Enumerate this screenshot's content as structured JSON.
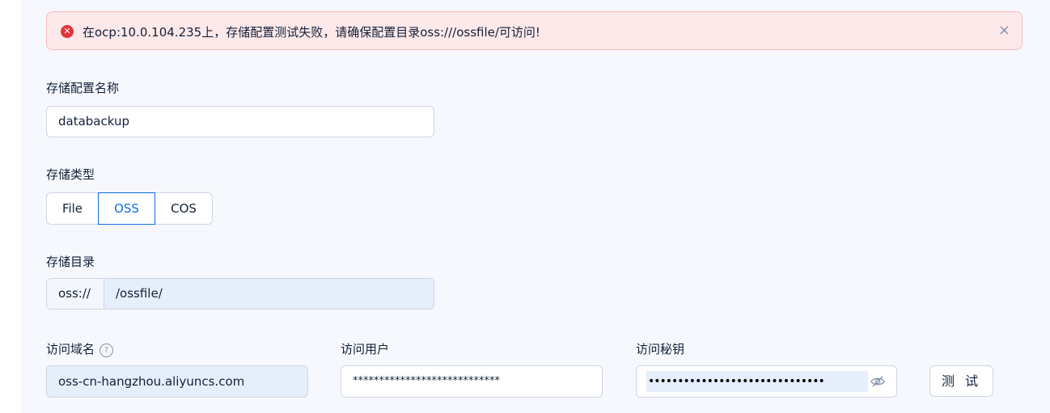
{
  "alert": {
    "message": "在ocp:10.0.104.235上，存储配置测试失败，请确保配置目录oss:///ossfile/可访问!",
    "close_glyph": "×",
    "icon": "error-circle-icon",
    "color": "#e5333b"
  },
  "form": {
    "name": {
      "label": "存储配置名称",
      "value": "databackup"
    },
    "type": {
      "label": "存储类型",
      "options": [
        "File",
        "OSS",
        "COS"
      ],
      "selected": "OSS"
    },
    "directory": {
      "label": "存储目录",
      "prefix": "oss://",
      "value": "/ossfile/"
    },
    "endpoint": {
      "label": "访问域名",
      "help_glyph": "?",
      "value": "oss-cn-hangzhou.aliyuncs.com"
    },
    "access_user": {
      "label": "访问用户",
      "value": "****************************"
    },
    "access_key": {
      "label": "访问秘钥",
      "value": "••••••••••••••••••••••••••••••",
      "eye_icon": "eye-hidden-icon"
    },
    "test_button": "测 试"
  },
  "colors": {
    "accent": "#0d6ce4",
    "error_bg": "#fee9ea",
    "error_border": "#f9b8bd",
    "panel_bg": "#f6f8fd"
  }
}
